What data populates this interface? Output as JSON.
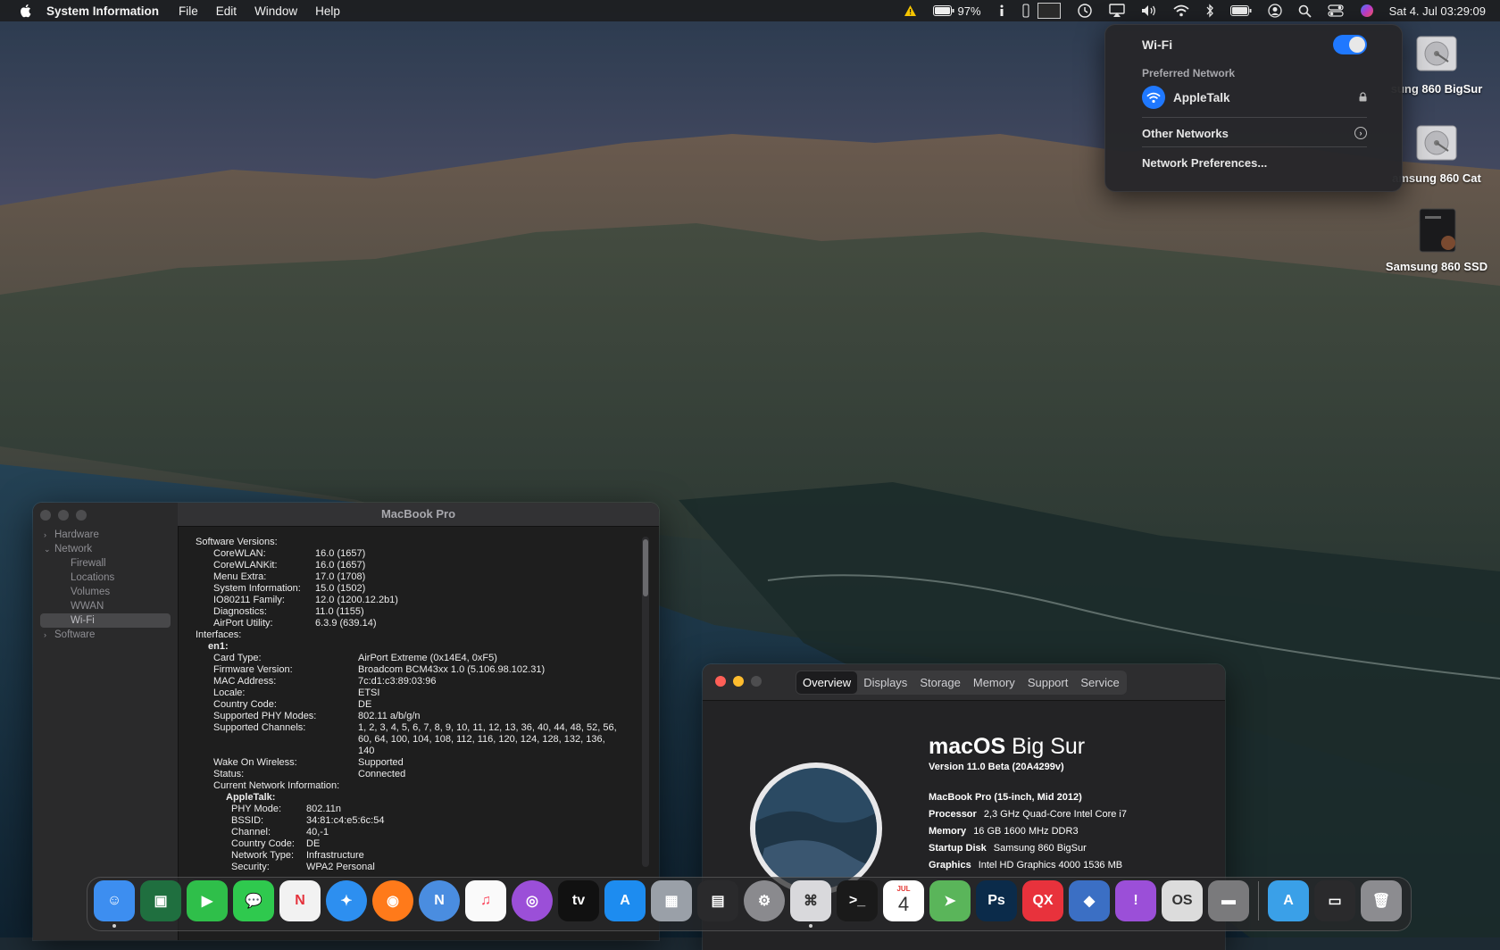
{
  "menubar": {
    "app_name": "System Information",
    "menus": [
      "File",
      "Edit",
      "Window",
      "Help"
    ],
    "battery_percent": "97%",
    "clock": "Sat 4. Jul  03:29:09",
    "status_icons": [
      "warning-icon",
      "battery-icon",
      "info-icon",
      "usb-icon",
      "display-icon",
      "time-machine-icon",
      "airplay-icon",
      "volume-icon",
      "wifi-icon",
      "bluetooth-icon",
      "battery-status-icon",
      "user-icon",
      "search-icon",
      "control-center-icon",
      "siri-icon"
    ]
  },
  "wifi_menu": {
    "title": "Wi-Fi",
    "enabled": true,
    "preferred_label": "Preferred Network",
    "network_name": "AppleTalk",
    "other_networks": "Other Networks",
    "preferences": "Network Preferences..."
  },
  "desktop": {
    "drives": [
      {
        "label": "sung 860 BigSur"
      },
      {
        "label": "amsung 860 Cat"
      },
      {
        "label": "Samsung 860 SSD"
      }
    ]
  },
  "sysinfo": {
    "title": "MacBook Pro",
    "nav": [
      {
        "label": "Hardware",
        "level": 0,
        "disclosure": "›"
      },
      {
        "label": "Network",
        "level": 0,
        "disclosure": "⌄"
      },
      {
        "label": "Firewall",
        "level": 1
      },
      {
        "label": "Locations",
        "level": 1
      },
      {
        "label": "Volumes",
        "level": 1
      },
      {
        "label": "WWAN",
        "level": 1
      },
      {
        "label": "Wi-Fi",
        "level": 1,
        "selected": true
      },
      {
        "label": "Software",
        "level": 0,
        "disclosure": "›"
      }
    ],
    "lines": [
      {
        "indent": 0,
        "k": "Software Versions:",
        "v": "",
        "bold": false
      },
      {
        "indent": 20,
        "k": "CoreWLAN:",
        "v": "16.0 (1657)",
        "kw": 114
      },
      {
        "indent": 20,
        "k": "CoreWLANKit:",
        "v": "16.0 (1657)",
        "kw": 114
      },
      {
        "indent": 20,
        "k": "Menu Extra:",
        "v": "17.0 (1708)",
        "kw": 114
      },
      {
        "indent": 20,
        "k": "System Information:",
        "v": "15.0 (1502)",
        "kw": 114
      },
      {
        "indent": 20,
        "k": "IO80211 Family:",
        "v": "12.0 (1200.12.2b1)",
        "kw": 114
      },
      {
        "indent": 20,
        "k": "Diagnostics:",
        "v": "11.0 (1155)",
        "kw": 114
      },
      {
        "indent": 20,
        "k": "AirPort Utility:",
        "v": "6.3.9 (639.14)",
        "kw": 114
      },
      {
        "indent": 0,
        "k": "Interfaces:",
        "v": ""
      },
      {
        "indent": 14,
        "k": "en1:",
        "v": "",
        "bold": true
      },
      {
        "indent": 20,
        "k": "Card Type:",
        "v": "AirPort Extreme  (0x14E4, 0xF5)",
        "kw": 162
      },
      {
        "indent": 20,
        "k": "Firmware Version:",
        "v": "Broadcom BCM43xx 1.0 (5.106.98.102.31)",
        "kw": 162
      },
      {
        "indent": 20,
        "k": "MAC Address:",
        "v": "7c:d1:c3:89:03:96",
        "kw": 162
      },
      {
        "indent": 20,
        "k": "Locale:",
        "v": "ETSI",
        "kw": 162
      },
      {
        "indent": 20,
        "k": "Country Code:",
        "v": "DE",
        "kw": 162
      },
      {
        "indent": 20,
        "k": "Supported PHY Modes:",
        "v": "802.11 a/b/g/n",
        "kw": 162
      },
      {
        "indent": 20,
        "k": "Supported Channels:",
        "v": "1, 2, 3, 4, 5, 6, 7, 8, 9, 10, 11, 12, 13, 36, 40, 44, 48, 52, 56,",
        "kw": 162
      },
      {
        "indent": 20,
        "k": "",
        "v": "60, 64, 100, 104, 108, 112, 116, 120, 124, 128, 132, 136,",
        "kw": 162
      },
      {
        "indent": 20,
        "k": "",
        "v": "140",
        "kw": 162
      },
      {
        "indent": 20,
        "k": "Wake On Wireless:",
        "v": "Supported",
        "kw": 162
      },
      {
        "indent": 20,
        "k": "Status:",
        "v": "Connected",
        "kw": 162
      },
      {
        "indent": 20,
        "k": "Current Network Information:",
        "v": ""
      },
      {
        "indent": 34,
        "k": "AppleTalk:",
        "v": "",
        "bold": true
      },
      {
        "indent": 40,
        "k": "PHY Mode:",
        "v": "802.11n",
        "kw": 84
      },
      {
        "indent": 40,
        "k": "BSSID:",
        "v": "34:81:c4:e5:6c:54",
        "kw": 84
      },
      {
        "indent": 40,
        "k": "Channel:",
        "v": "40,-1",
        "kw": 84
      },
      {
        "indent": 40,
        "k": "Country Code:",
        "v": "DE",
        "kw": 84
      },
      {
        "indent": 40,
        "k": "Network Type:",
        "v": "Infrastructure",
        "kw": 84
      },
      {
        "indent": 40,
        "k": "Security:",
        "v": "WPA2 Personal",
        "kw": 84
      }
    ]
  },
  "about": {
    "tabs": [
      "Overview",
      "Displays",
      "Storage",
      "Memory",
      "Support",
      "Service"
    ],
    "active_tab": "Overview",
    "os_name_bold": "macOS",
    "os_name_light": "Big Sur",
    "version": "Version 11.0 Beta (20A4299v)",
    "specs": [
      {
        "k": "",
        "v": "MacBook Pro (15-inch, Mid 2012)"
      },
      {
        "k": "Processor",
        "v": "2,3 GHz Quad-Core Intel Core i7"
      },
      {
        "k": "Memory",
        "v": "16 GB 1600 MHz DDR3"
      },
      {
        "k": "Startup Disk",
        "v": "Samsung 860 BigSur"
      },
      {
        "k": "Graphics",
        "v": "Intel HD Graphics 4000 1536 MB"
      }
    ]
  },
  "dock": {
    "calendar_month": "JUL",
    "calendar_day": "4",
    "apps": [
      {
        "name": "finder",
        "bg": "#3d8ef0",
        "glyph": "☺",
        "running": true
      },
      {
        "name": "photo-booth",
        "bg": "#1f6f3f",
        "glyph": "▣",
        "running": false
      },
      {
        "name": "facetime",
        "bg": "#2fbf4a",
        "glyph": "▶",
        "running": false
      },
      {
        "name": "messages",
        "bg": "#2fc94e",
        "glyph": "💬",
        "running": false
      },
      {
        "name": "news",
        "bg": "#f2f2f2",
        "glyph": "N",
        "running": false
      },
      {
        "name": "safari",
        "bg": "#2d8ff0",
        "glyph": "✦",
        "running": false
      },
      {
        "name": "firefox",
        "bg": "#ff7a1a",
        "glyph": "◉",
        "running": false
      },
      {
        "name": "nova",
        "bg": "#4a8de0",
        "glyph": "N",
        "running": false
      },
      {
        "name": "music",
        "bg": "#fafafa",
        "glyph": "♫",
        "running": false
      },
      {
        "name": "podcasts",
        "bg": "#9b4fd8",
        "glyph": "◎",
        "running": false
      },
      {
        "name": "tv",
        "bg": "#111111",
        "glyph": "tv",
        "running": false
      },
      {
        "name": "app-store",
        "bg": "#1d8cf0",
        "glyph": "A",
        "running": false
      },
      {
        "name": "launchpad",
        "bg": "#9aa0a8",
        "glyph": "▦",
        "running": false
      },
      {
        "name": "mission-control",
        "bg": "#2a2a2c",
        "glyph": "▤",
        "running": false
      },
      {
        "name": "system-preferences",
        "bg": "#8a8a8e",
        "glyph": "⚙",
        "running": false
      },
      {
        "name": "system-information",
        "bg": "#d9d9dc",
        "glyph": "⌘",
        "running": true
      },
      {
        "name": "terminal",
        "bg": "#1a1a1a",
        "glyph": ">_",
        "running": false
      },
      {
        "name": "calendar",
        "bg": "#ffffff",
        "glyph": "",
        "running": false
      },
      {
        "name": "maps",
        "bg": "#5ab55a",
        "glyph": "➤",
        "running": false
      },
      {
        "name": "photoshop",
        "bg": "#0b2b4a",
        "glyph": "Ps",
        "running": false
      },
      {
        "name": "quarkxpress",
        "bg": "#e8323c",
        "glyph": "QX",
        "running": false
      },
      {
        "name": "vectorworks",
        "bg": "#3b6fc4",
        "glyph": "◆",
        "running": false
      },
      {
        "name": "feedback-assistant",
        "bg": "#9b4fd8",
        "glyph": "!",
        "running": false
      },
      {
        "name": "macos-installer",
        "bg": "#dcdcdc",
        "glyph": "OS",
        "running": false
      },
      {
        "name": "printer",
        "bg": "#7a7a7c",
        "glyph": "▬",
        "running": false
      },
      {
        "sep": true
      },
      {
        "name": "applications-folder",
        "bg": "#3aa0e8",
        "glyph": "A",
        "running": false
      },
      {
        "name": "screenshot-stack",
        "bg": "#2a2a2c",
        "glyph": "▭",
        "running": false
      },
      {
        "name": "trash",
        "bg": "#8c8c90",
        "glyph": "🗑",
        "running": false
      }
    ]
  }
}
